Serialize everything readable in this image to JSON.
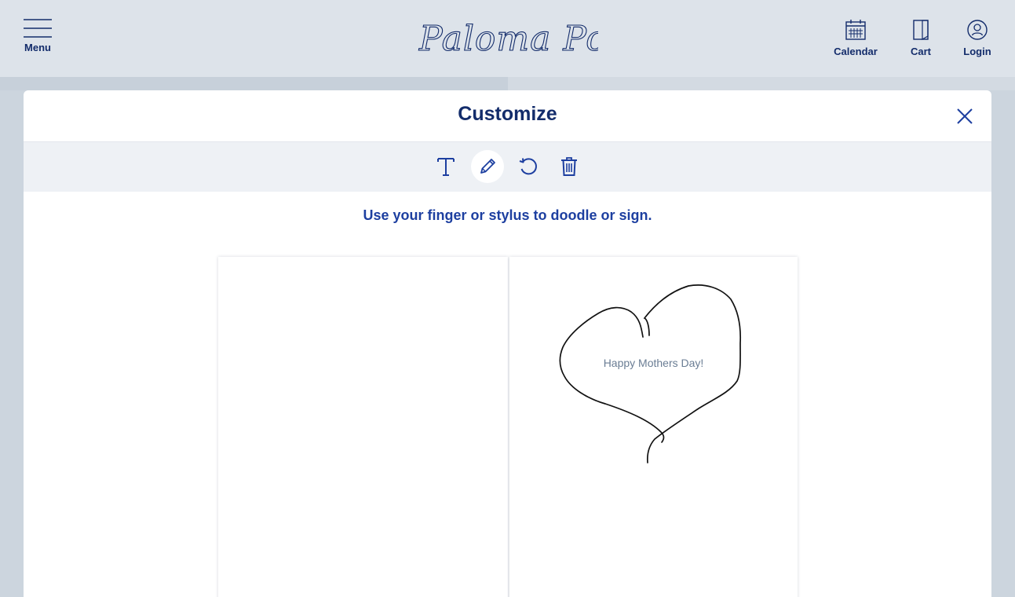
{
  "header": {
    "menu_label": "Menu",
    "logo_text": "Paloma Post",
    "nav": {
      "calendar_label": "Calendar",
      "cart_label": "Cart",
      "login_label": "Login"
    }
  },
  "modal": {
    "title": "Customize",
    "instruction": "Use your finger or stylus to doodle or sign.",
    "card": {
      "inside_right_text": "Happy Mothers Day!"
    }
  },
  "colors": {
    "brand_navy": "#132c6b",
    "instruction_blue": "#1d3fa0",
    "header_bg": "#dde3ea",
    "toolbar_bg": "#eef1f5"
  }
}
